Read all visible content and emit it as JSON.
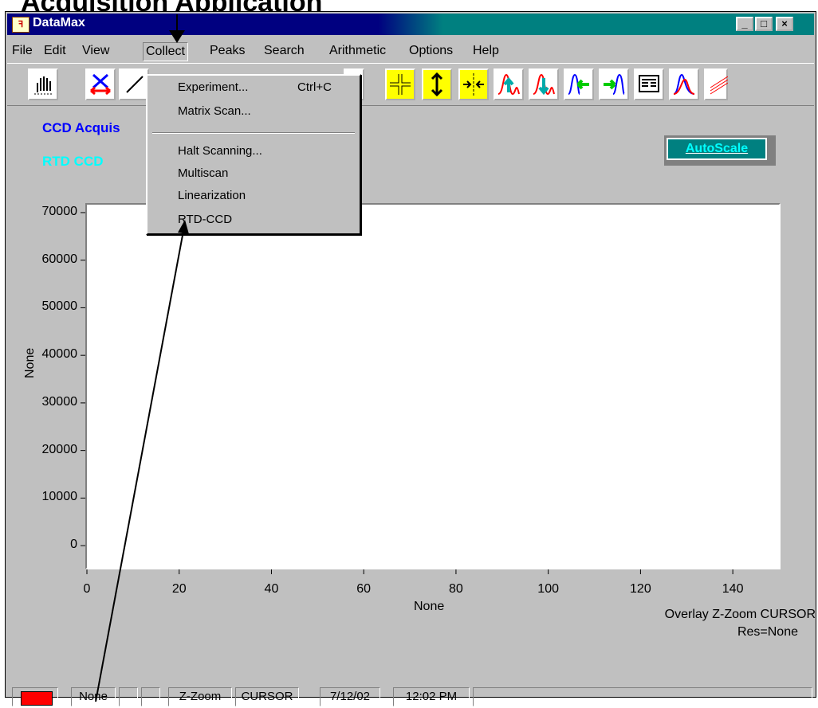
{
  "heading": "Acquisition Application",
  "window": {
    "title": "DataMax",
    "controls": [
      "_",
      "□",
      "×"
    ]
  },
  "menu": [
    {
      "label": "File",
      "key": "F"
    },
    {
      "label": "Edit",
      "key": "E"
    },
    {
      "label": "View",
      "key": "V"
    },
    {
      "label": "Collect",
      "key": "C"
    },
    {
      "label": "Peaks",
      "key": "P"
    },
    {
      "label": "Search",
      "key": "S"
    },
    {
      "label": "Arithmetic",
      "key": "A"
    },
    {
      "label": "Options",
      "key": "O"
    },
    {
      "label": "Help",
      "key": "H"
    }
  ],
  "collect_menu": {
    "items": [
      {
        "label": "Experiment...",
        "shortcut": "Ctrl+C"
      },
      {
        "label": "Matrix Scan..."
      },
      {
        "label": "Halt Scanning..."
      },
      {
        "label": "Multiscan"
      },
      {
        "label": "Linearization"
      },
      {
        "label": "RTD-CCD"
      }
    ]
  },
  "toolbar_icons": [
    "hand-tool-icon",
    "zoom-x-icon",
    "pan-icon",
    "vertical-move-icon",
    "compress-icon",
    "peak-up-icon",
    "peak-down-icon",
    "shift-left-icon",
    "shift-right-icon",
    "table-icon",
    "overlay-icon",
    "stack-icon"
  ],
  "labels": {
    "acquisition": "CCD Acquis",
    "rtd": "RTD CCD",
    "autoscale": "AutoScale"
  },
  "chart_data": {
    "type": "line",
    "xlabel": "None",
    "ylabel": "None",
    "xlim": [
      0,
      150
    ],
    "ylim": [
      -5000,
      72000
    ],
    "x_ticks": [
      "0",
      "20",
      "40",
      "60",
      "80",
      "100",
      "120",
      "140"
    ],
    "y_ticks": [
      "70000",
      "60000",
      "50000",
      "40000",
      "30000",
      "20000",
      "10000",
      "0"
    ],
    "series": []
  },
  "overlay": {
    "line1": "Overlay Z-Zoom CURSOR",
    "line2": "Res=None"
  },
  "status": {
    "cells": [
      "None",
      "",
      "",
      "Z-Zoom",
      "CURSOR",
      "7/12/02",
      "12:02 PM",
      ""
    ]
  },
  "colors": {
    "title_active": "#000080",
    "acq_label": "#0000ff",
    "rtd_label": "#00ffff",
    "autoscale_bg": "#008080",
    "status_indicator": "#ff0000"
  }
}
